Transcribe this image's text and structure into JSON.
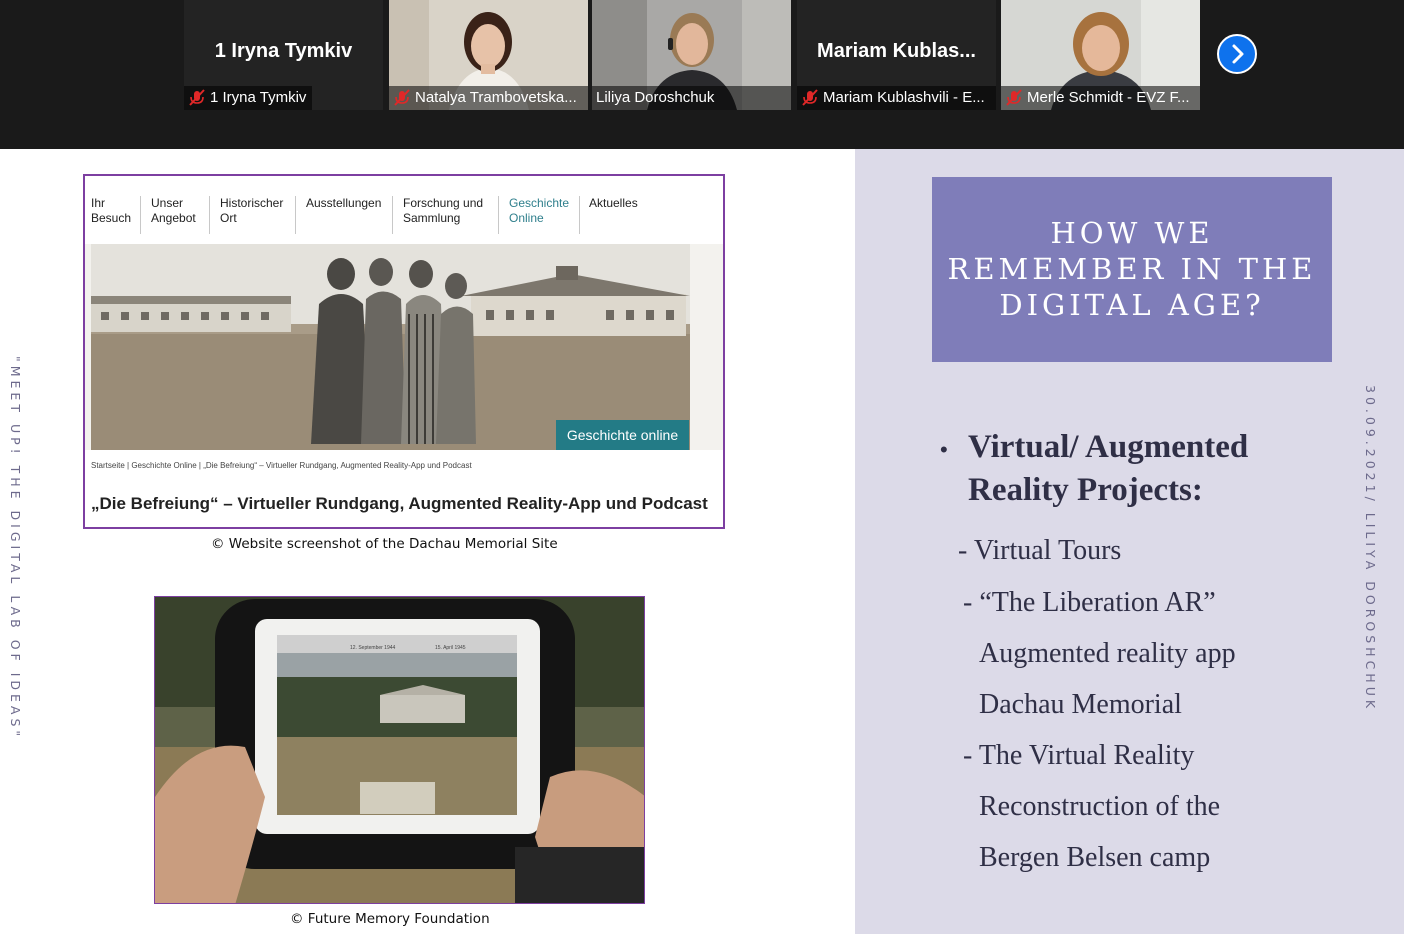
{
  "participants": [
    {
      "display_name": "1 Iryna Tymkiv",
      "label": "1 Iryna Tymkiv",
      "muted": true,
      "video": false
    },
    {
      "label": "Natalya Trambovetska...",
      "muted": true,
      "video": true
    },
    {
      "label": "Liliya Doroshchuk",
      "muted": false,
      "video": true,
      "active_speaker": true
    },
    {
      "display_name": "Mariam Kublas...",
      "label": "Mariam Kublashvili - E...",
      "muted": true,
      "video": false
    },
    {
      "label": "Merle Schmidt - EVZ F...",
      "muted": true,
      "video": true
    }
  ],
  "strip": {
    "next_icon": "chevron-right-icon"
  },
  "slide": {
    "left_vertical_text": "\"MEET UP! THE DIGITAL LAB OF IDEAS\"",
    "right_vertical_text": "30.09.2021/ LILIYA DOROSHCHUK",
    "website": {
      "nav": [
        {
          "line1": "Ihr",
          "line2": "Besuch"
        },
        {
          "line1": "Unser",
          "line2": "Angebot"
        },
        {
          "line1": "Historischer",
          "line2": "Ort"
        },
        {
          "line1": "Ausstellungen",
          "line2": ""
        },
        {
          "line1": "Forschung und",
          "line2": "Sammlung"
        },
        {
          "line1": "Geschichte",
          "line2": "Online",
          "active": true
        },
        {
          "line1": "Aktuelles",
          "line2": ""
        }
      ],
      "hero_button": "Geschichte online",
      "breadcrumbs": "Startseite | Geschichte Online | „Die Befreiung“ – Virtueller Rundgang, Augmented Reality-App und Podcast",
      "page_title": "„Die Befreiung“ – Virtueller Rundgang, Augmented Reality-App und Podcast",
      "caption": "© Website screenshot of the Dachau Memorial Site"
    },
    "photo": {
      "caption": "©  Future Memory Foundation",
      "date_left": "12. September 1944",
      "date_right": "15. April 1945"
    },
    "title": [
      "HOW WE",
      "REMEMBER IN THE",
      "DIGITAL AGE?"
    ],
    "heading": [
      "Virtual/ Augmented",
      "Reality Projects:"
    ],
    "items": [
      "- Virtual Tours",
      "- “The Liberation AR”",
      "Augmented reality app",
      "Dachau  Memorial",
      "- The Virtual Reality",
      "Reconstruction of the",
      "Bergen Belsen camp"
    ],
    "colors": {
      "title_box": "#7f7db9",
      "right_panel": "#dcdae8",
      "accent_teal": "#237b86",
      "frame_purple": "#7d3fa1"
    }
  }
}
